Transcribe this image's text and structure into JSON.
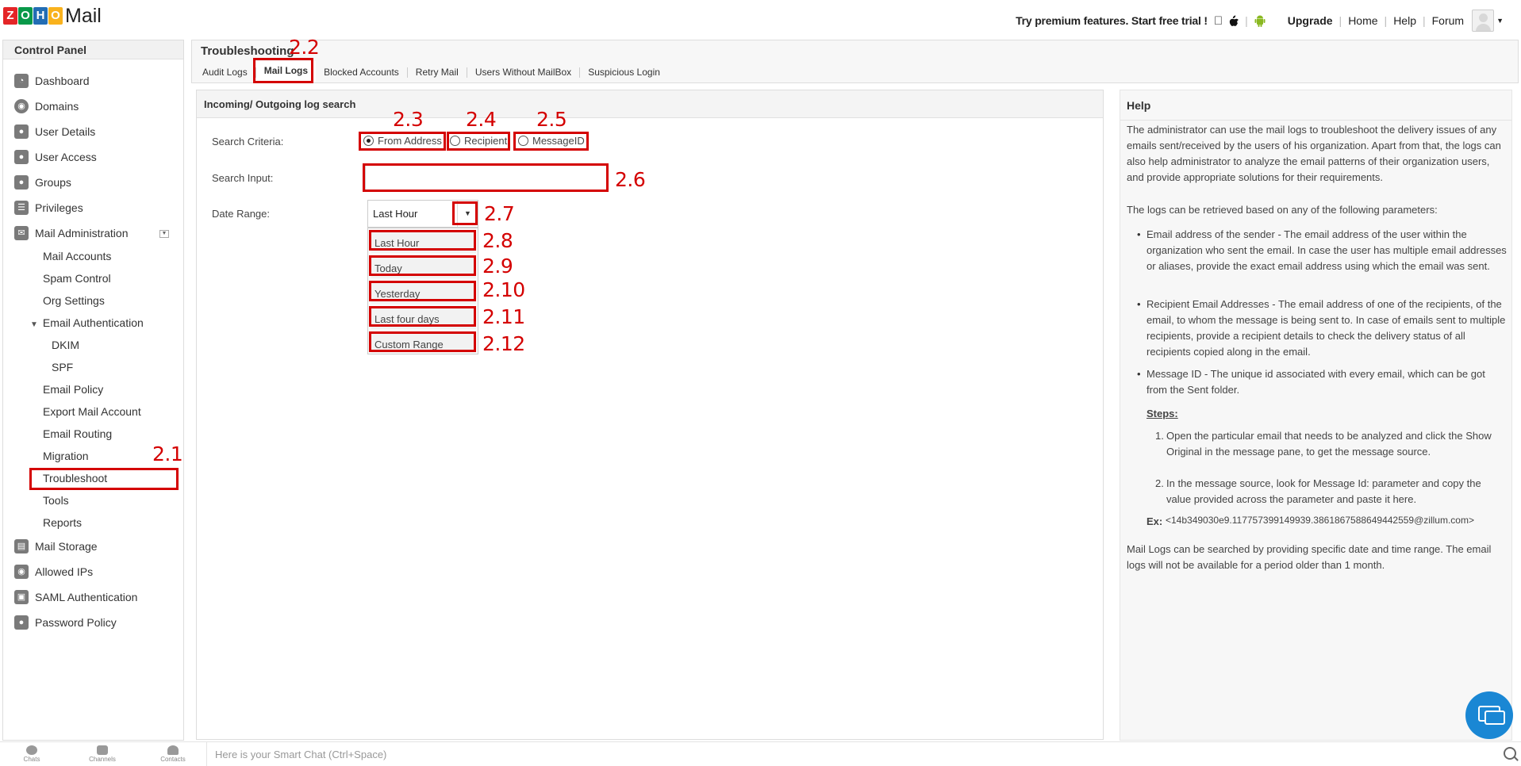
{
  "app": {
    "logo_letters": [
      "Z",
      "O",
      "H",
      "O"
    ],
    "logo_colors": [
      "#e42527",
      "#089949",
      "#226db4",
      "#f9b21d"
    ],
    "logo_text": "Mail"
  },
  "topbar": {
    "trial_text": "Try premium features. Start free trial !",
    "apple_icon": "apple-icon",
    "android_icon": "android-icon",
    "links": [
      "Upgrade",
      "Home",
      "Help",
      "Forum"
    ]
  },
  "sidebar": {
    "title": "Control Panel",
    "main_items": [
      {
        "label": "Dashboard",
        "icon": "dashboard-icon"
      },
      {
        "label": "Domains",
        "icon": "globe-icon"
      },
      {
        "label": "User Details",
        "icon": "user-icon"
      },
      {
        "label": "User Access",
        "icon": "user-access-icon"
      },
      {
        "label": "Groups",
        "icon": "groups-icon"
      },
      {
        "label": "Privileges",
        "icon": "privileges-icon"
      },
      {
        "label": "Mail Administration",
        "icon": "mail-icon"
      }
    ],
    "sub_items": [
      "Mail Accounts",
      "Spam Control",
      "Org Settings",
      "Email Authentication"
    ],
    "auth_items": [
      "DKIM",
      "SPF"
    ],
    "sub_items_2": [
      "Email Policy",
      "Export Mail Account",
      "Email Routing",
      "Migration",
      "Troubleshoot",
      "Tools",
      "Reports"
    ],
    "bottom_items": [
      {
        "label": "Mail Storage",
        "icon": "storage-icon"
      },
      {
        "label": "Allowed IPs",
        "icon": "ip-icon"
      },
      {
        "label": "SAML Authentication",
        "icon": "saml-icon"
      },
      {
        "label": "Password Policy",
        "icon": "lock-icon"
      }
    ]
  },
  "content": {
    "title": "Troubleshooting",
    "tabs": [
      "Audit Logs",
      "Mail Logs",
      "Blocked Accounts",
      "Retry Mail",
      "Users Without MailBox",
      "Suspicious Login"
    ],
    "active_tab": "Mail Logs"
  },
  "search_panel": {
    "title": "Incoming/ Outgoing log search",
    "criteria_label": "Search Criteria:",
    "criteria_options": [
      "From Address",
      "Recipient",
      "MessageID"
    ],
    "criteria_selected": "From Address",
    "input_label": "Search Input:",
    "input_value": "",
    "date_label": "Date Range:",
    "date_selected": "Last Hour",
    "date_options": [
      "Last Hour",
      "Today",
      "Yesterday",
      "Last four days",
      "Custom Range"
    ]
  },
  "annotations": [
    "2.1",
    "2.2",
    "2.3",
    "2.4",
    "2.5",
    "2.6",
    "2.7",
    "2.8",
    "2.9",
    "2.10",
    "2.11",
    "2.12"
  ],
  "annotation_color": "#d40000",
  "help": {
    "title": "Help",
    "intro": "The administrator can use the mail logs to troubleshoot the delivery issues of any emails sent/received by the users of his organization. Apart from that, the logs can also help administrator to analyze the email patterns of their organization users, and provide appropriate solutions for their requirements.",
    "params_intro": "The logs can be retrieved based on any of the following parameters:",
    "bullets": [
      "Email address of the sender - The email address of the user within the organization who sent the email. In case the user has multiple email addresses or aliases, provide the exact email address using which the email was sent.",
      "Recipient Email Addresses - The email address of one of the recipients, of the email, to whom the message is being sent to. In case of emails sent to multiple recipients, provide a recipient details to check the delivery status of all recipients copied along in the email.",
      "Message ID - The unique id associated with every email, which can be got from the Sent folder."
    ],
    "steps_title": "Steps:",
    "steps": [
      "Open the particular email that needs to be analyzed and click the Show Original in the message pane, to get the message source.",
      "In the message source, look for Message Id: parameter and copy the value provided across the parameter and paste it here."
    ],
    "ex_label": "Ex:",
    "ex_value": "<14b349030e9.117757399149939.3861867588649442559@zillum.com>",
    "footer": "Mail Logs can be searched by providing specific date and time range. The email logs will not be available for a period older than 1 month."
  },
  "bottombar": {
    "items": [
      "Chats",
      "Channels",
      "Contacts"
    ],
    "chat_placeholder": "Here is your Smart Chat (Ctrl+Space)"
  }
}
